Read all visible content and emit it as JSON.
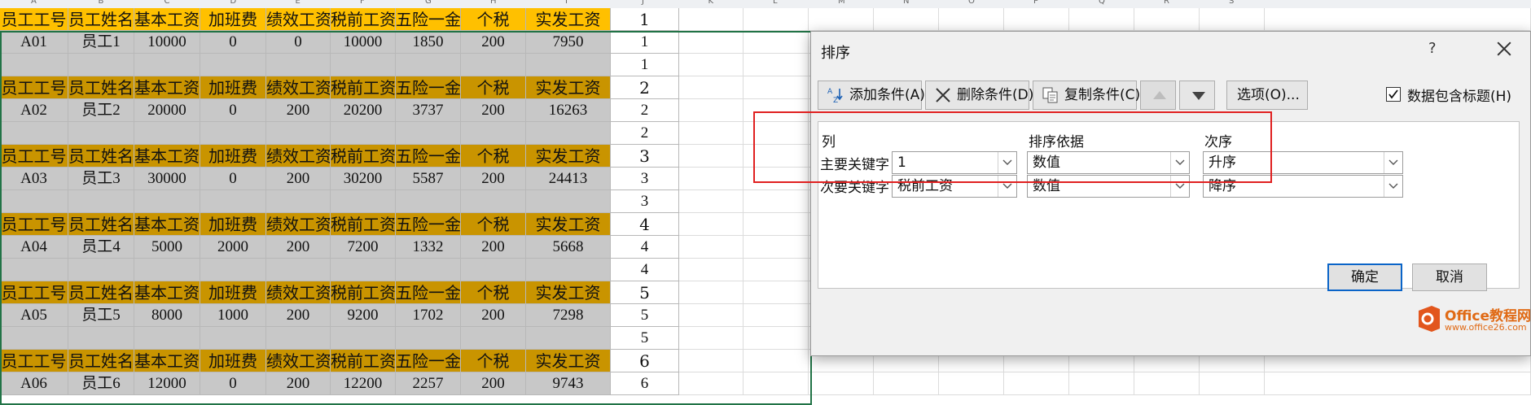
{
  "sheet": {
    "column_letters": [
      "A",
      "B",
      "C",
      "D",
      "E",
      "F",
      "G",
      "H",
      "I",
      "J",
      "K",
      "L",
      "M",
      "N",
      "O",
      "P",
      "Q",
      "R",
      "S"
    ],
    "headers": [
      "员工工号",
      "员工姓名",
      "基本工资",
      "加班费",
      "绩效工资",
      "税前工资",
      "五险一金",
      "个税",
      "实发工资"
    ],
    "records": [
      {
        "id": "A01",
        "name": "员工1",
        "base": "10000",
        "overtime": "0",
        "perf": "0",
        "pretax": "10000",
        "insurance": "1850",
        "tax": "200",
        "net": "7950",
        "key": "1"
      },
      {
        "id": "A02",
        "name": "员工2",
        "base": "20000",
        "overtime": "0",
        "perf": "200",
        "pretax": "20200",
        "insurance": "3737",
        "tax": "200",
        "net": "16263",
        "key": "2"
      },
      {
        "id": "A03",
        "name": "员工3",
        "base": "30000",
        "overtime": "0",
        "perf": "200",
        "pretax": "30200",
        "insurance": "5587",
        "tax": "200",
        "net": "24413",
        "key": "3"
      },
      {
        "id": "A04",
        "name": "员工4",
        "base": "5000",
        "overtime": "2000",
        "perf": "200",
        "pretax": "7200",
        "insurance": "1332",
        "tax": "200",
        "net": "5668",
        "key": "4"
      },
      {
        "id": "A05",
        "name": "员工5",
        "base": "8000",
        "overtime": "1000",
        "perf": "200",
        "pretax": "9200",
        "insurance": "1702",
        "tax": "200",
        "net": "7298",
        "key": "5"
      },
      {
        "id": "A06",
        "name": "员工6",
        "base": "12000",
        "overtime": "0",
        "perf": "200",
        "pretax": "12200",
        "insurance": "2257",
        "tax": "200",
        "net": "9743",
        "key": "6"
      }
    ]
  },
  "dialog": {
    "title": "排序",
    "help": "?",
    "toolbar": {
      "add_condition": "添加条件(A)",
      "delete_condition": "删除条件(D)",
      "copy_condition": "复制条件(C)",
      "options": "选项(O)...",
      "has_headers_label": "数据包含标题(H)",
      "has_headers_checked": true
    },
    "columns": {
      "col": "列",
      "sort_on": "排序依据",
      "order": "次序"
    },
    "conditions": [
      {
        "label": "主要关键字",
        "column": "1",
        "sort_on": "数值",
        "order": "升序"
      },
      {
        "label": "次要关键字",
        "column": "税前工资",
        "sort_on": "数值",
        "order": "降序"
      }
    ],
    "ok": "确定",
    "cancel": "取消"
  },
  "watermark": {
    "brand": "Office教程网",
    "url": "www.office26.com"
  },
  "colors": {
    "header_first": "#ffc000",
    "header": "#c99400",
    "data_bg": "#c8c8c8",
    "selection": "#217346",
    "highlight": "#e02020",
    "brand": "#e06a15"
  }
}
